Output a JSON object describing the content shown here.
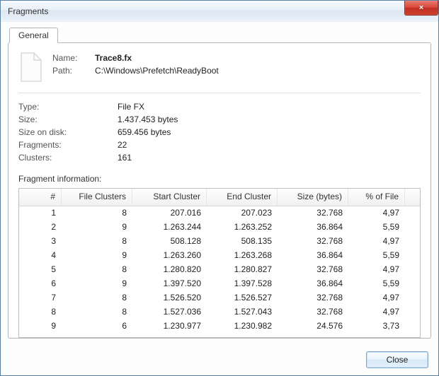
{
  "window": {
    "title": "Fragments",
    "close_icon": "×"
  },
  "tab": {
    "general": "General"
  },
  "header": {
    "name_label": "Name:",
    "name_value": "Trace8.fx",
    "path_label": "Path:",
    "path_value": "C:\\Windows\\Prefetch\\ReadyBoot"
  },
  "props": {
    "type_label": "Type:",
    "type_value": "File FX",
    "size_label": "Size:",
    "size_value": "1.437.453 bytes",
    "size_on_disk_label": "Size on disk:",
    "size_on_disk_value": "659.456 bytes",
    "fragments_label": "Fragments:",
    "fragments_value": "22",
    "clusters_label": "Clusters:",
    "clusters_value": "161"
  },
  "grid": {
    "title": "Fragment information:",
    "columns": {
      "num": "#",
      "file_clusters": "File Clusters",
      "start_cluster": "Start Cluster",
      "end_cluster": "End Cluster",
      "size_bytes": "Size (bytes)",
      "pct_file": "% of File"
    },
    "rows": [
      {
        "num": "1",
        "fc": "8",
        "sc": "207.016",
        "ec": "207.023",
        "sz": "32.768",
        "pct": "4,97"
      },
      {
        "num": "2",
        "fc": "9",
        "sc": "1.263.244",
        "ec": "1.263.252",
        "sz": "36.864",
        "pct": "5,59"
      },
      {
        "num": "3",
        "fc": "8",
        "sc": "508.128",
        "ec": "508.135",
        "sz": "32.768",
        "pct": "4,97"
      },
      {
        "num": "4",
        "fc": "9",
        "sc": "1.263.260",
        "ec": "1.263.268",
        "sz": "36.864",
        "pct": "5,59"
      },
      {
        "num": "5",
        "fc": "8",
        "sc": "1.280.820",
        "ec": "1.280.827",
        "sz": "32.768",
        "pct": "4,97"
      },
      {
        "num": "6",
        "fc": "9",
        "sc": "1.397.520",
        "ec": "1.397.528",
        "sz": "36.864",
        "pct": "5,59"
      },
      {
        "num": "7",
        "fc": "8",
        "sc": "1.526.520",
        "ec": "1.526.527",
        "sz": "32.768",
        "pct": "4,97"
      },
      {
        "num": "8",
        "fc": "8",
        "sc": "1.527.036",
        "ec": "1.527.043",
        "sz": "32.768",
        "pct": "4,97"
      },
      {
        "num": "9",
        "fc": "6",
        "sc": "1.230.977",
        "ec": "1.230.982",
        "sz": "24.576",
        "pct": "3,73"
      }
    ]
  },
  "footer": {
    "close_label": "Close"
  }
}
